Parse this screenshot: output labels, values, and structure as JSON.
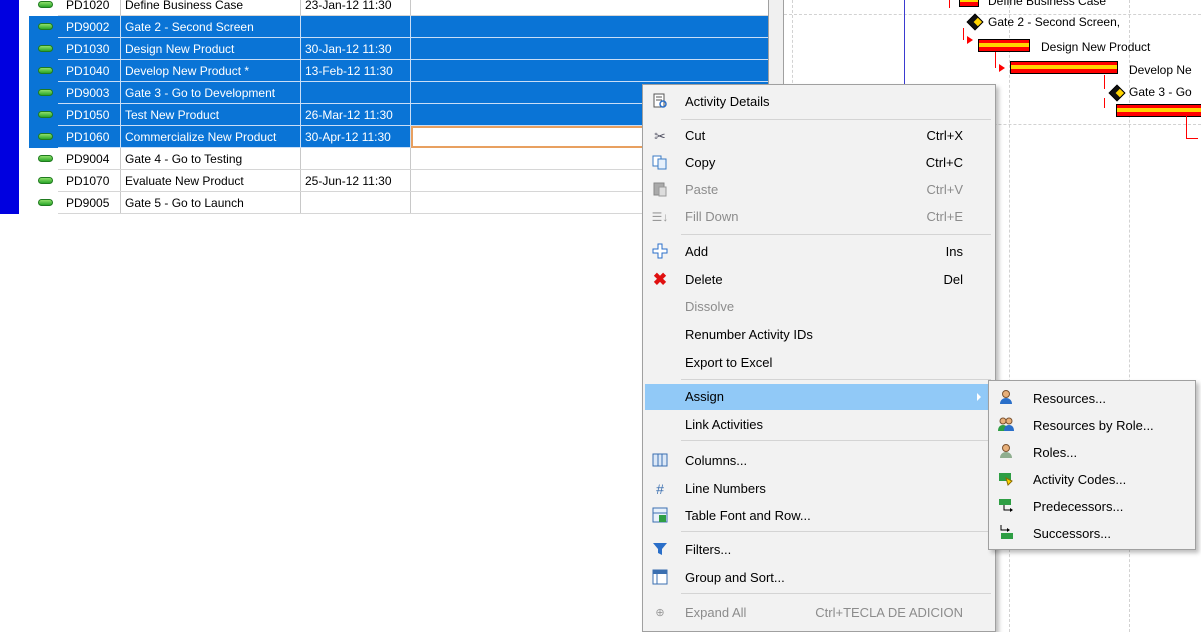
{
  "rows": [
    {
      "id": "PD1020",
      "name": "Define Business Case",
      "date": "23-Jan-12 11:30",
      "selected": false
    },
    {
      "id": "PD9002",
      "name": "Gate 2 - Second Screen",
      "date": "",
      "selected": true
    },
    {
      "id": "PD1030",
      "name": "Design New Product",
      "date": "30-Jan-12 11:30",
      "selected": true
    },
    {
      "id": "PD1040",
      "name": "Develop New Product *",
      "date": "13-Feb-12 11:30",
      "selected": true
    },
    {
      "id": "PD9003",
      "name": "Gate 3 - Go to Development",
      "date": "",
      "selected": true
    },
    {
      "id": "PD1050",
      "name": "Test New Product",
      "date": "26-Mar-12 11:30",
      "selected": true
    },
    {
      "id": "PD1060",
      "name": "Commercialize New Product",
      "date": "30-Apr-12 11:30",
      "selected": true
    },
    {
      "id": "PD9004",
      "name": "Gate 4 - Go to Testing",
      "date": "",
      "selected": false
    },
    {
      "id": "PD1070",
      "name": "Evaluate New Product",
      "date": "25-Jun-12 11:30",
      "selected": false
    },
    {
      "id": "PD9005",
      "name": "Gate 5 - Go to Launch",
      "date": "",
      "selected": false
    }
  ],
  "gantt": {
    "labels": {
      "define": "Define Business Case",
      "gate2": "Gate 2 - Second Screen,",
      "design": "Design New Product",
      "develop": "Develop Ne",
      "gate3": "Gate 3 - Go"
    }
  },
  "context_menu": {
    "activity_details": {
      "label": "Activity Details",
      "icon": "activity-details-icon"
    },
    "cut": {
      "label": "Cut",
      "shortcut": "Ctrl+X",
      "icon": "scissors-icon"
    },
    "copy": {
      "label": "Copy",
      "shortcut": "Ctrl+C",
      "icon": "copy-icon"
    },
    "paste": {
      "label": "Paste",
      "shortcut": "Ctrl+V",
      "icon": "paste-icon",
      "disabled": true
    },
    "fill_down": {
      "label": "Fill Down",
      "shortcut": "Ctrl+E",
      "icon": "fill-down-icon",
      "disabled": true
    },
    "add": {
      "label": "Add",
      "shortcut": "Ins",
      "icon": "add-icon"
    },
    "delete": {
      "label": "Delete",
      "shortcut": "Del",
      "icon": "delete-icon"
    },
    "dissolve": {
      "label": "Dissolve",
      "disabled": true
    },
    "renumber": {
      "label": "Renumber Activity IDs"
    },
    "export": {
      "label": "Export to Excel"
    },
    "assign": {
      "label": "Assign",
      "highlighted": true
    },
    "link": {
      "label": "Link Activities"
    },
    "columns": {
      "label": "Columns...",
      "icon": "columns-icon"
    },
    "line_numbers": {
      "label": "Line Numbers",
      "icon": "hash-icon"
    },
    "table_font": {
      "label": "Table Font and Row...",
      "icon": "table-font-icon"
    },
    "filters": {
      "label": "Filters...",
      "icon": "filter-icon"
    },
    "group_sort": {
      "label": "Group and Sort...",
      "icon": "group-sort-icon"
    },
    "expand_all": {
      "label": "Expand All",
      "shortcut": "Ctrl+TECLA DE ADICION",
      "icon": "expand-icon",
      "disabled": true
    }
  },
  "assign_submenu": {
    "resources": "Resources...",
    "resources_by_role": "Resources by Role...",
    "roles": "Roles...",
    "activity_codes": "Activity Codes...",
    "predecessors": "Predecessors...",
    "successors": "Successors..."
  },
  "colors": {
    "selection": "#0a74d6",
    "menu_highlight": "#91c9f7",
    "row_marker": "#0000e0",
    "gantt_bar": "#ff0000",
    "gantt_bar_stripe": "#ffd400"
  }
}
